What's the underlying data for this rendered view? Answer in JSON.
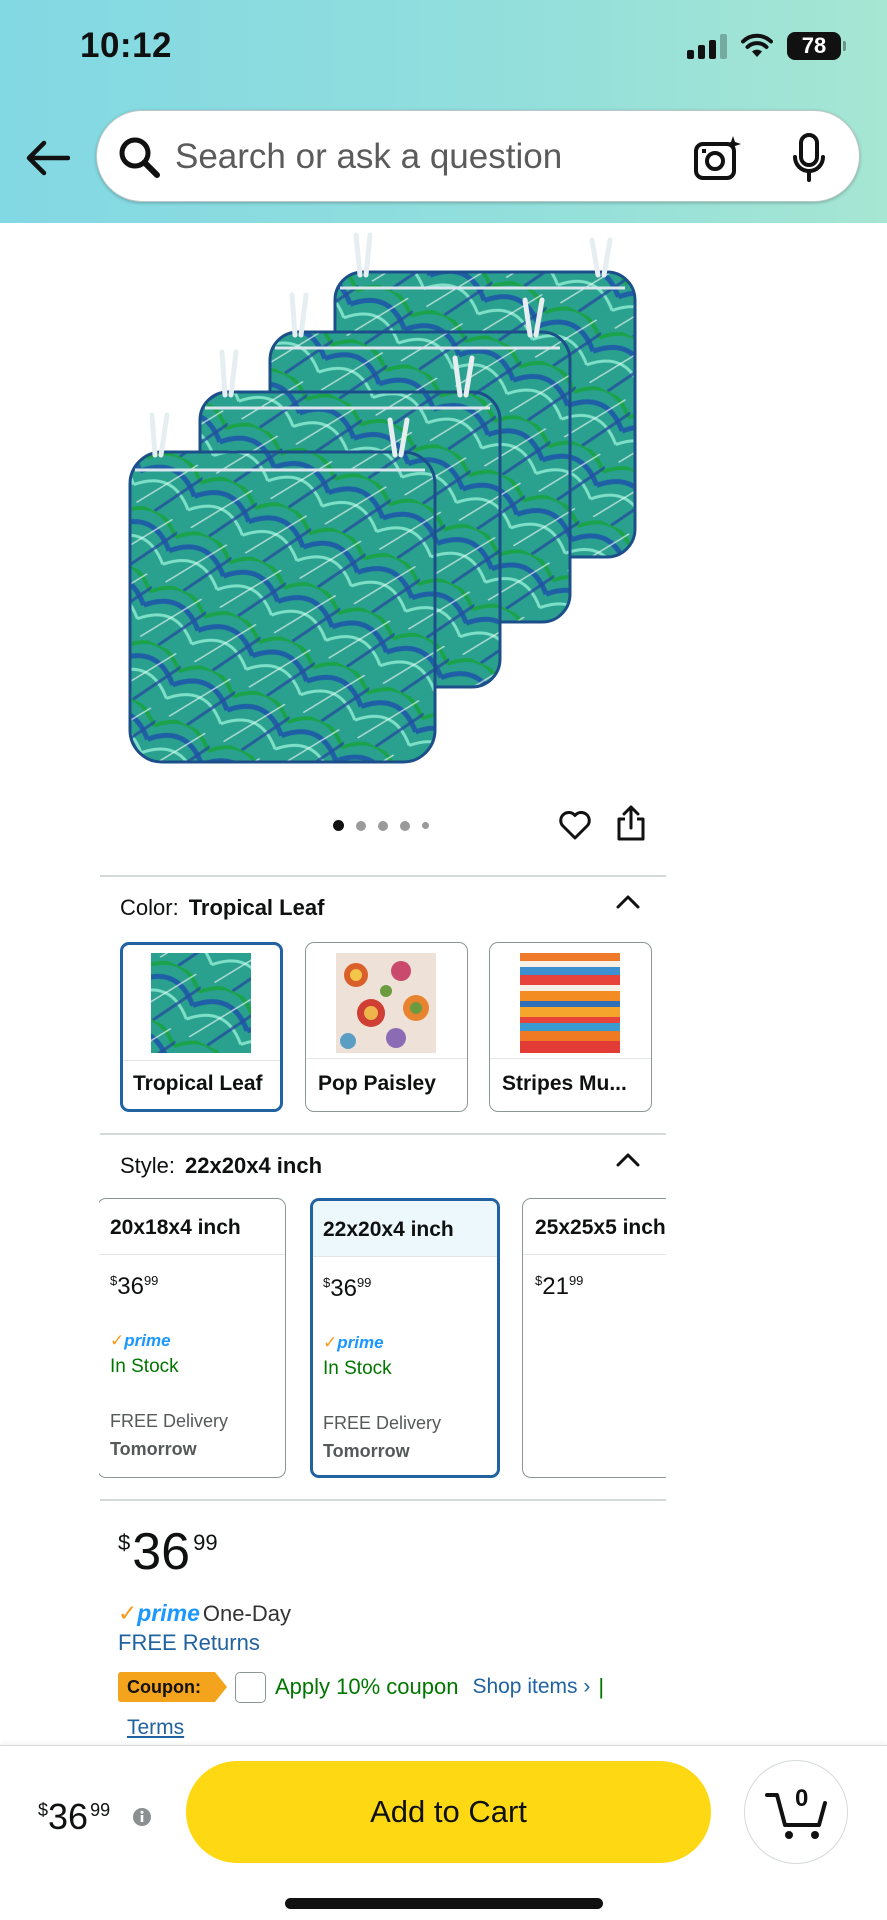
{
  "status_bar": {
    "time": "10:12",
    "battery": "78"
  },
  "search": {
    "placeholder": "Search or ask a question"
  },
  "image_carousel": {
    "total": 5,
    "active": 1
  },
  "color": {
    "label": "Color:",
    "selected": "Tropical Leaf",
    "options": [
      {
        "label": "Tropical Leaf"
      },
      {
        "label": "Pop Paisley"
      },
      {
        "label": "Stripes Mu..."
      }
    ]
  },
  "style": {
    "label": "Style:",
    "selected": "22x20x4 inch",
    "options": [
      {
        "name": "20x18x4 inch",
        "price_whole": "36",
        "price_cents": "99",
        "prime": "prime",
        "stock": "In Stock",
        "delivery": "FREE Delivery",
        "delivery_day": "Tomorrow"
      },
      {
        "name": "22x20x4 inch",
        "price_whole": "36",
        "price_cents": "99",
        "prime": "prime",
        "stock": "In Stock",
        "delivery": "FREE Delivery",
        "delivery_day": "Tomorrow"
      },
      {
        "name": "25x25x5 inch",
        "price_whole": "21",
        "price_cents": "99"
      }
    ]
  },
  "price": {
    "currency": "$",
    "whole": "36",
    "cents": "99",
    "prime_logo": "prime",
    "prime_text": "One-Day",
    "returns": "FREE Returns"
  },
  "coupon": {
    "tag": "Coupon:",
    "apply": "Apply 10% coupon",
    "shop_items": "Shop items ›",
    "separator": "|",
    "terms": "Terms"
  },
  "bottom_bar": {
    "currency": "$",
    "price_whole": "36",
    "price_cents": "99",
    "add_to_cart": "Add to Cart",
    "cart_count": "0"
  },
  "colors": {
    "accent_blue": "#2162a1",
    "prime_blue": "#1a98ff",
    "in_stock_green": "#007600",
    "cart_yellow": "#ffd814",
    "coupon_orange": "#f4a31d"
  }
}
